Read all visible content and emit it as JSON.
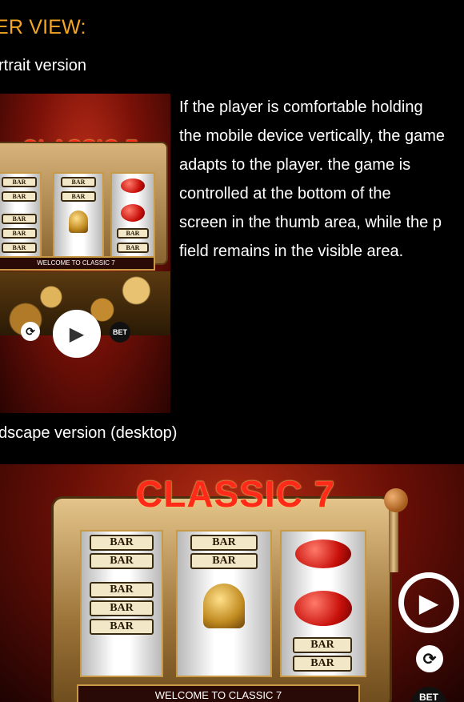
{
  "heading": "ER VIEW:",
  "portrait_label": "rtrait version",
  "landscape_label": "dscape version (desktop)",
  "description_lines": [
    "If the player is comfortable holding",
    "the mobile device vertically, the game",
    "adapts to the player. the game is",
    "controlled at the bottom of the",
    "screen in the thumb area, while the p",
    "field remains in the visible area."
  ],
  "game": {
    "logo": "CLASSIC 7",
    "welcome": "WELCOME TO CLASSIC 7",
    "bar_text": "BAR",
    "bet_label": "BET"
  },
  "colors": {
    "heading": "#f5a623",
    "logo": "#ff2a1a"
  }
}
